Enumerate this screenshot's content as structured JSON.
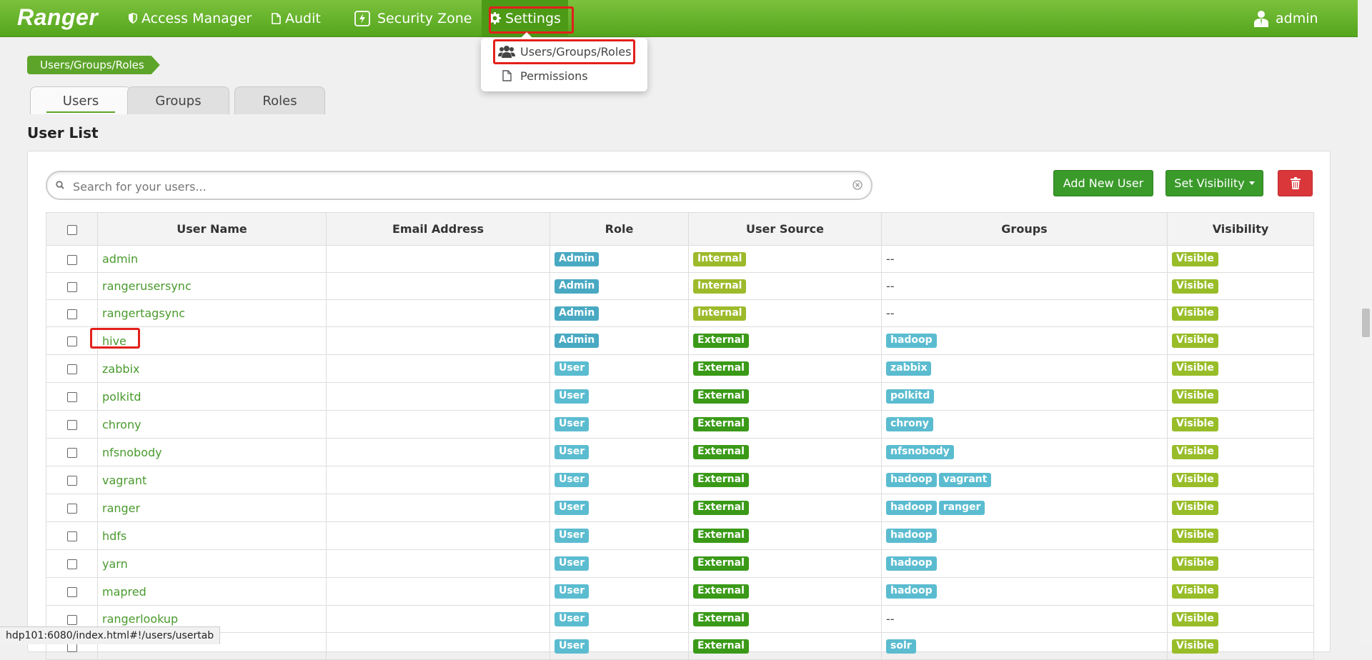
{
  "nav": {
    "brand": "Ranger",
    "items": [
      {
        "label": "Access Manager",
        "icon": "shield-icon"
      },
      {
        "label": "Audit",
        "icon": "file-icon"
      },
      {
        "label": "Security Zone",
        "icon": "zone-icon"
      },
      {
        "label": "Settings",
        "icon": "gear-icon"
      }
    ],
    "user": "admin"
  },
  "settings_menu": {
    "items": [
      {
        "label": "Users/Groups/Roles",
        "icon": "users-icon"
      },
      {
        "label": "Permissions",
        "icon": "file-icon"
      }
    ]
  },
  "breadcrumb": "Users/Groups/Roles",
  "tabs": [
    "Users",
    "Groups",
    "Roles"
  ],
  "active_tab": "Users",
  "section_title": "User List",
  "search": {
    "placeholder": "Search for your users...",
    "value": ""
  },
  "buttons": {
    "add_user": "Add New User",
    "set_visibility": "Set Visibility"
  },
  "table": {
    "columns": [
      "User Name",
      "Email Address",
      "Role",
      "User Source",
      "Groups",
      "Visibility"
    ],
    "rows": [
      {
        "name": "admin",
        "email": "",
        "role": "Admin",
        "source": "Internal",
        "groups": [],
        "visibility": "Visible"
      },
      {
        "name": "rangerusersync",
        "email": "",
        "role": "Admin",
        "source": "Internal",
        "groups": [],
        "visibility": "Visible"
      },
      {
        "name": "rangertagsync",
        "email": "",
        "role": "Admin",
        "source": "Internal",
        "groups": [],
        "visibility": "Visible"
      },
      {
        "name": "hive",
        "email": "",
        "role": "Admin",
        "source": "External",
        "groups": [
          "hadoop"
        ],
        "visibility": "Visible"
      },
      {
        "name": "zabbix",
        "email": "",
        "role": "User",
        "source": "External",
        "groups": [
          "zabbix"
        ],
        "visibility": "Visible"
      },
      {
        "name": "polkitd",
        "email": "",
        "role": "User",
        "source": "External",
        "groups": [
          "polkitd"
        ],
        "visibility": "Visible"
      },
      {
        "name": "chrony",
        "email": "",
        "role": "User",
        "source": "External",
        "groups": [
          "chrony"
        ],
        "visibility": "Visible"
      },
      {
        "name": "nfsnobody",
        "email": "",
        "role": "User",
        "source": "External",
        "groups": [
          "nfsnobody"
        ],
        "visibility": "Visible"
      },
      {
        "name": "vagrant",
        "email": "",
        "role": "User",
        "source": "External",
        "groups": [
          "hadoop",
          "vagrant"
        ],
        "visibility": "Visible"
      },
      {
        "name": "ranger",
        "email": "",
        "role": "User",
        "source": "External",
        "groups": [
          "hadoop",
          "ranger"
        ],
        "visibility": "Visible"
      },
      {
        "name": "hdfs",
        "email": "",
        "role": "User",
        "source": "External",
        "groups": [
          "hadoop"
        ],
        "visibility": "Visible"
      },
      {
        "name": "yarn",
        "email": "",
        "role": "User",
        "source": "External",
        "groups": [
          "hadoop"
        ],
        "visibility": "Visible"
      },
      {
        "name": "mapred",
        "email": "",
        "role": "User",
        "source": "External",
        "groups": [
          "hadoop"
        ],
        "visibility": "Visible"
      },
      {
        "name": "rangerlookup",
        "email": "",
        "role": "User",
        "source": "External",
        "groups": [],
        "visibility": "Visible"
      },
      {
        "name": "",
        "email": "",
        "role": "User",
        "source": "External",
        "groups": [
          "solr"
        ],
        "visibility": "Visible"
      }
    ],
    "empty_groups_text": "--"
  },
  "status_url": "hdp101:6080/index.html#!/users/usertab"
}
